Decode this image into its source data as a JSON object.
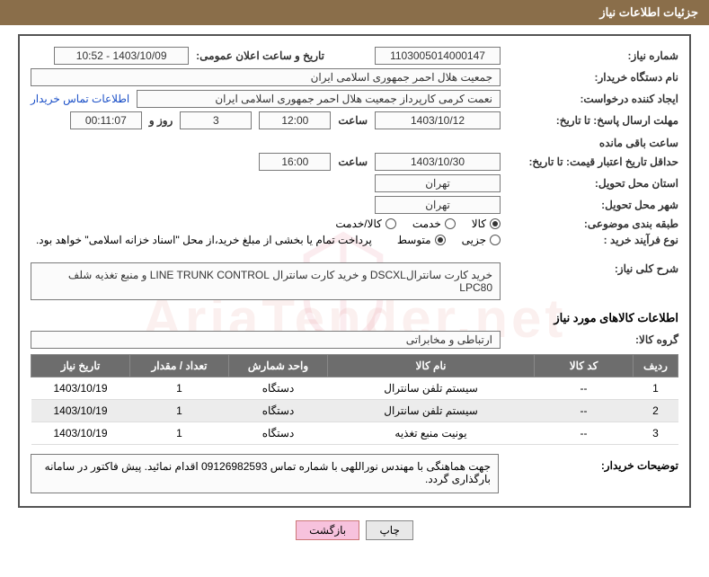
{
  "header_title": "جزئیات اطلاعات نیاز",
  "labels": {
    "need_number": "شماره نیاز:",
    "announce_datetime": "تاریخ و ساعت اعلان عمومی:",
    "buyer_org": "نام دستگاه خریدار:",
    "requester": "ایجاد کننده درخواست:",
    "buyer_contact": "اطلاعات تماس خریدار",
    "reply_deadline": "مهلت ارسال پاسخ: تا تاریخ:",
    "hour": "ساعت",
    "days_and": "روز و",
    "remaining": "ساعت باقی مانده",
    "quote_validity": "حداقل تاریخ اعتبار قیمت: تا تاریخ:",
    "delivery_province": "استان محل تحویل:",
    "delivery_city": "شهر محل تحویل:",
    "subject_category": "طبقه بندی موضوعی:",
    "purchase_type": "نوع فرآیند خرید :",
    "need_desc": "شرح کلی نیاز:",
    "items_info": "اطلاعات کالاهای مورد نیاز",
    "item_group": "گروه کالا:",
    "buyer_notes": "توضیحات خریدار:"
  },
  "values": {
    "need_number": "1103005014000147",
    "announce_datetime": "1403/10/09 - 10:52",
    "buyer_org": "جمعیت هلال احمر جمهوری اسلامی ایران",
    "requester": "نعمت کرمی کارپرداز جمعیت هلال احمر جمهوری اسلامی ایران",
    "reply_date": "1403/10/12",
    "reply_time": "12:00",
    "days_remaining": "3",
    "time_remaining": "00:11:07",
    "quote_date": "1403/10/30",
    "quote_time": "16:00",
    "province": "تهران",
    "city": "تهران",
    "purchase_note": "پرداخت تمام یا بخشی از مبلغ خرید،از محل \"اسناد خزانه اسلامی\" خواهد بود.",
    "need_desc_text": "خرید کارت سانترالDSCXL و خرید کارت سانترال LINE TRUNK CONTROL و منبع تغذیه شلف LPC80",
    "item_group_value": "ارتباطی و مخابراتی",
    "buyer_notes_text": "جهت هماهنگی با مهندس نوراللهی با شماره تماس 09126982593 اقدام نمائید. پیش فاکتور در سامانه بارگذاری گردد."
  },
  "radios": {
    "category": {
      "kala": "کالا",
      "khadamat": "خدمت",
      "kala_khadamat": "کالا/خدمت",
      "selected": "kala"
    },
    "type": {
      "jozi": "جزیی",
      "motavaset": "متوسط",
      "selected": "motavaset"
    }
  },
  "table": {
    "headers": {
      "row": "ردیف",
      "code": "کد کالا",
      "name": "نام کالا",
      "unit": "واحد شمارش",
      "qty": "تعداد / مقدار",
      "date": "تاریخ نیاز"
    },
    "rows": [
      {
        "row": "1",
        "code": "--",
        "name": "سیستم تلفن سانترال",
        "unit": "دستگاه",
        "qty": "1",
        "date": "1403/10/19"
      },
      {
        "row": "2",
        "code": "--",
        "name": "سیستم تلفن سانترال",
        "unit": "دستگاه",
        "qty": "1",
        "date": "1403/10/19"
      },
      {
        "row": "3",
        "code": "--",
        "name": "یونیت منبع تغذیه",
        "unit": "دستگاه",
        "qty": "1",
        "date": "1403/10/19"
      }
    ]
  },
  "buttons": {
    "print": "چاپ",
    "back": "بازگشت"
  },
  "watermark": "AriaTender.net"
}
